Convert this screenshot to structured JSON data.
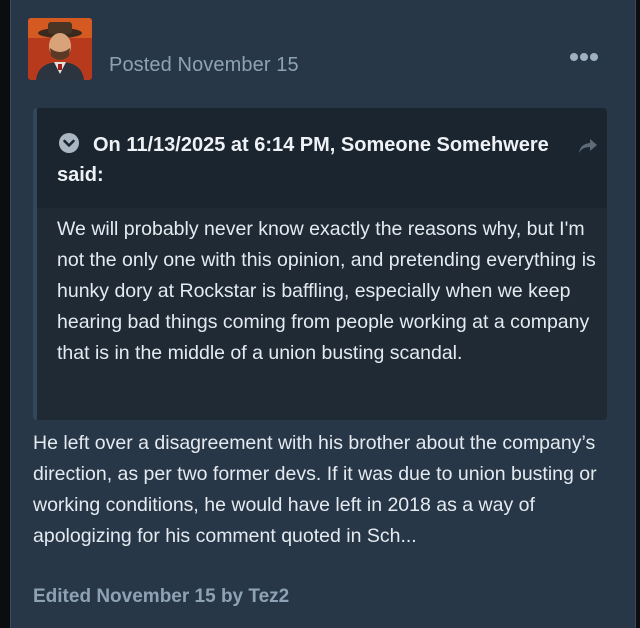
{
  "post": {
    "author_avatar_icon": "avatar-cowboy-portrait",
    "posted_label": "Posted November 15",
    "more_icon": "more-options-icon",
    "edited_label": "Edited November 15 by Tez2"
  },
  "quote": {
    "collapse_icon": "chevron-down-icon",
    "citation": "On 11/13/2025 at 6:14 PM, Someone Somehwere said:",
    "share_icon": "share-arrow-icon",
    "body": "We will probably never know exactly the reasons why, but I'm not the only one with this opinion, and pretending everything is hunky dory at Rockstar is baffling, especially when we keep hearing bad things coming from people working at a company that is in the middle of a union busting scandal."
  },
  "reply": {
    "text": "He left over a disagreement with his brother about the company’s direction, as per two former devs. If it was due to union busting or working conditions, he would have left in 2018 as a way of apologizing for his comment quoted in Sch..."
  },
  "colors": {
    "post_background": "#283747",
    "quote_background": "#1f2a35",
    "muted_text": "#8ea2b6",
    "body_text": "#e4eaf0"
  }
}
